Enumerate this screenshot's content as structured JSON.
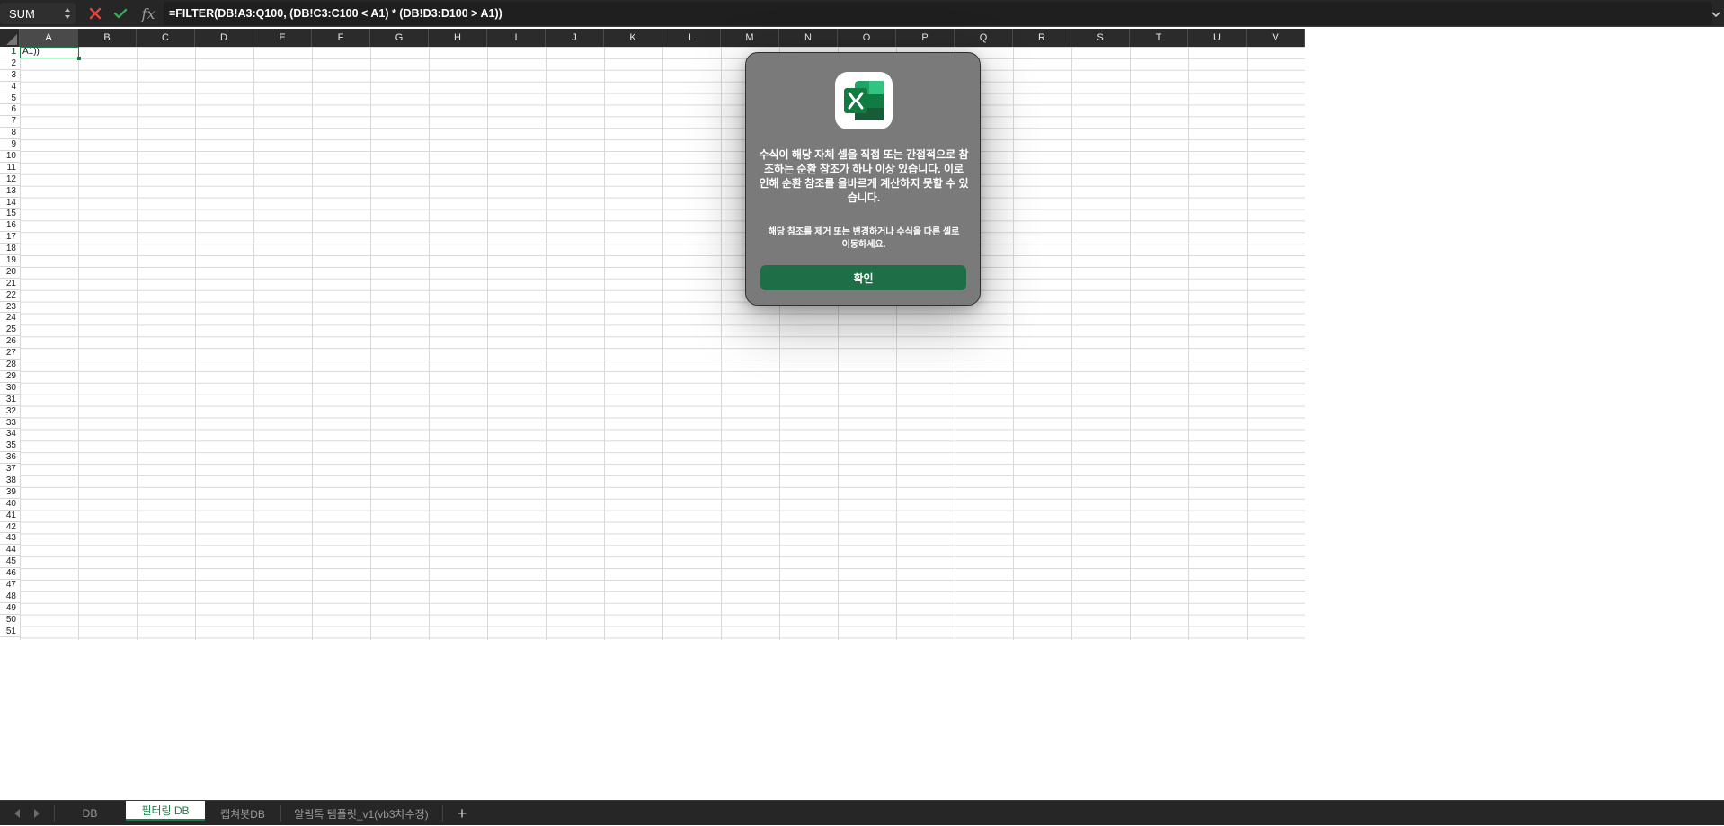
{
  "formula_bar": {
    "name_box": "SUM",
    "fx_label": "fx",
    "formula": "=FILTER(DB!A3:Q100, (DB!C3:C100 < A1) * (DB!D3:D100 > A1))"
  },
  "grid": {
    "columns": [
      "A",
      "B",
      "C",
      "D",
      "E",
      "F",
      "G",
      "H",
      "I",
      "J",
      "K",
      "L",
      "M",
      "N",
      "O",
      "P",
      "Q",
      "R",
      "S",
      "T",
      "U",
      "V"
    ],
    "rows": [
      "1",
      "2",
      "3",
      "4",
      "5",
      "6",
      "7",
      "8",
      "9",
      "10",
      "11",
      "12",
      "13",
      "14",
      "15",
      "16",
      "17",
      "18",
      "19",
      "20",
      "21",
      "22",
      "23",
      "24",
      "25",
      "26",
      "27",
      "28",
      "29",
      "30",
      "31",
      "32",
      "33",
      "34",
      "35",
      "36",
      "37",
      "38",
      "39",
      "40",
      "41",
      "42",
      "43",
      "44",
      "45",
      "46",
      "47",
      "48",
      "49",
      "50",
      "51"
    ],
    "active_cell_text": "A1))"
  },
  "dialog": {
    "app_icon": "excel-icon",
    "message": "수식이 해당 자체 셀을 직접 또는 간접적으로 참조하는 순환 참조가 하나 이상 있습니다. 이로 인해 순환 참조를 올바르게 계산하지 못할 수 있습니다.",
    "sub_message": "해당 참조를 제거 또는 변경하거나 수식을 다른 셀로 이동하세요.",
    "ok_label": "확인"
  },
  "sheet_tabs": {
    "tabs": [
      "DB",
      "필터링 DB",
      "캡쳐봇DB",
      "알림톡 템플릿_v1(vb3차수정)"
    ],
    "active_index": 1,
    "add_label": "+"
  },
  "colors": {
    "excel_green": "#1e7a46",
    "dialog_bg": "#7a7a7a",
    "ok_button": "#1e6e47",
    "toolbar_bg": "#262626"
  }
}
